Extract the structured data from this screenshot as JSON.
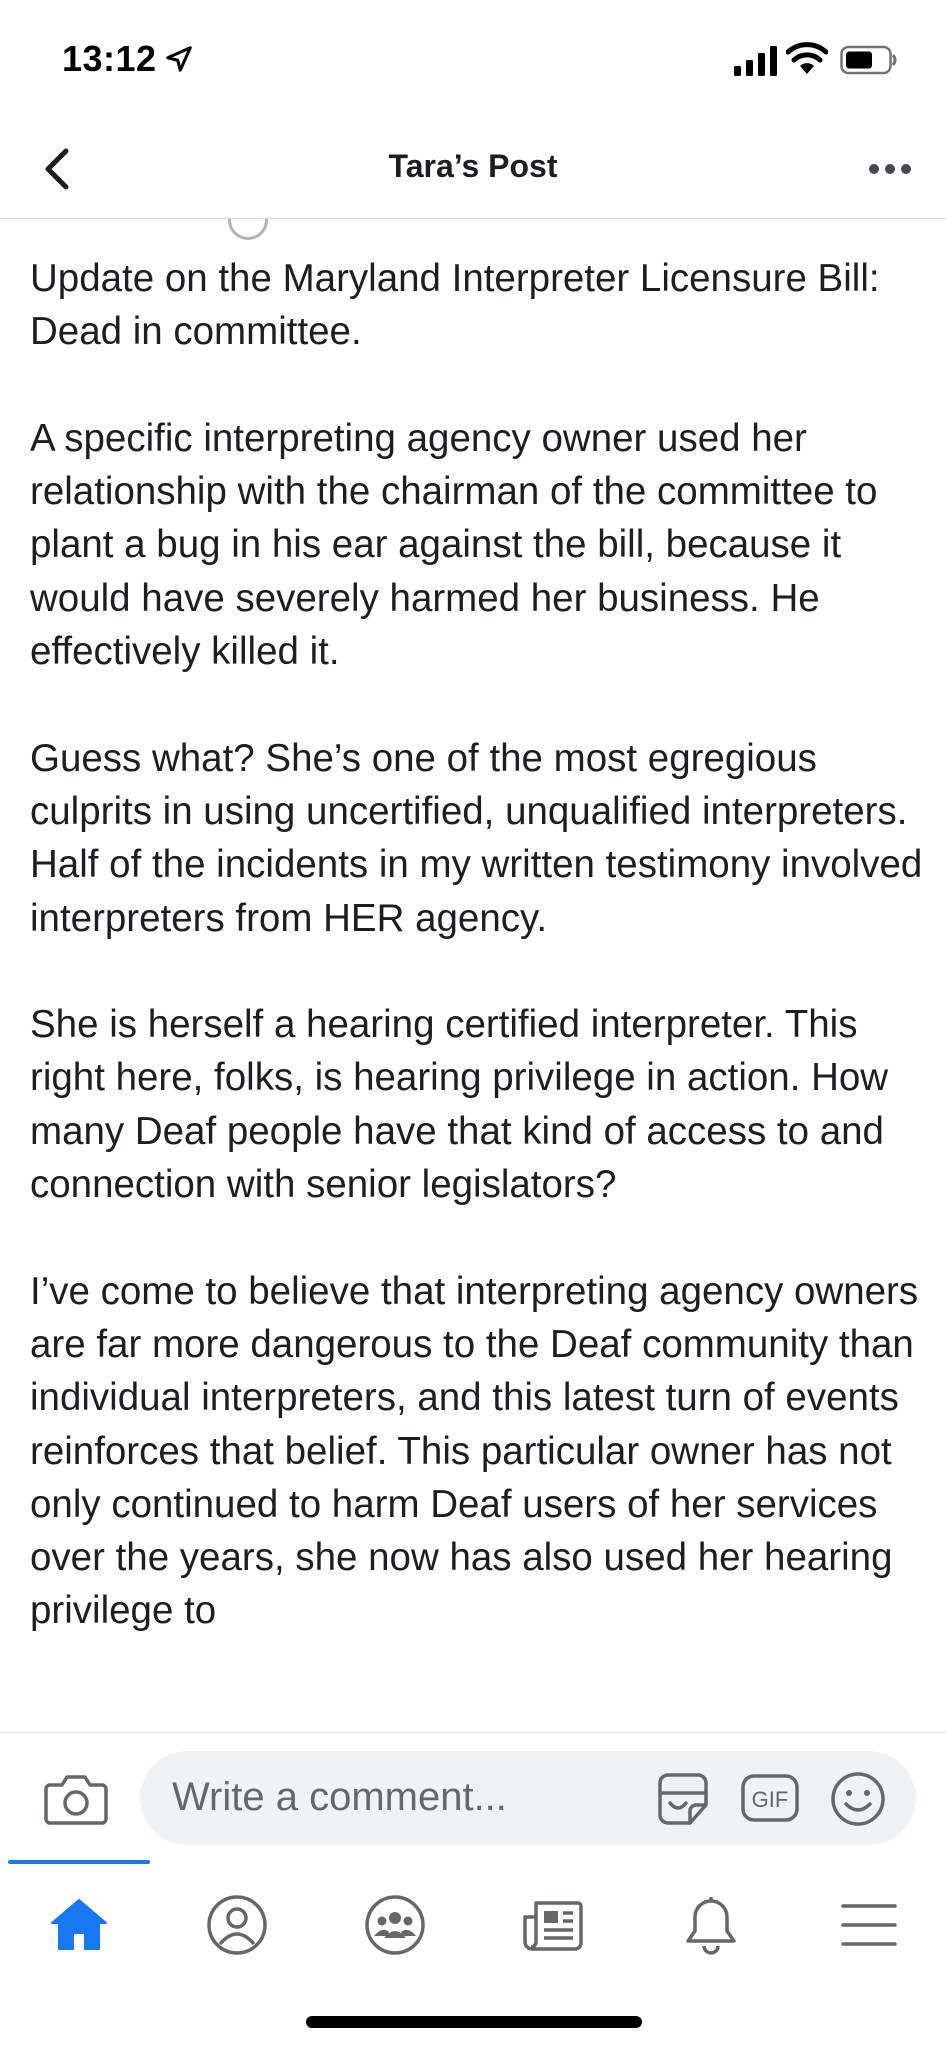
{
  "status_bar": {
    "time": "13:12",
    "icons": [
      "location-arrow-icon",
      "cellular-signal-icon",
      "wifi-icon",
      "battery-icon"
    ]
  },
  "nav": {
    "title": "Tara’s Post",
    "back_icon": "chevron-left-icon",
    "more_icon": "ellipsis-icon"
  },
  "post": {
    "paragraphs": [
      "Update on the Maryland Interpreter Licensure Bill: Dead in committee.",
      "A specific interpreting agency owner used her relationship with the chairman of the committee to plant a bug in his ear against the bill, because it would have severely harmed her business. He effectively killed it.",
      "Guess what? She’s one of the most egregious culprits in using uncertified, unqualified interpreters. Half of the incidents in my written testimony involved interpreters from HER agency.",
      "She is herself a hearing certified interpreter. This right here, folks, is hearing privilege in action. How many Deaf people have that kind of access to and connection with senior legislators?",
      "I’ve come to believe that interpreting agency owners are far more dangerous to the Deaf community than individual interpreters, and this latest turn of events reinforces that belief. This particular owner has not only continued to harm Deaf users of her services over the years, she now has also used her hearing privilege to"
    ]
  },
  "comment_bar": {
    "placeholder": "Write a comment...",
    "gif_label": "GIF",
    "icons": [
      "camera-icon",
      "sticker-icon",
      "gif-icon",
      "emoji-icon"
    ]
  },
  "tab_bar": {
    "active_tab": "home",
    "tabs": [
      {
        "id": "home",
        "icon": "home-icon"
      },
      {
        "id": "profile",
        "icon": "profile-icon"
      },
      {
        "id": "groups",
        "icon": "groups-icon"
      },
      {
        "id": "news",
        "icon": "news-icon"
      },
      {
        "id": "notifications",
        "icon": "bell-icon"
      },
      {
        "id": "menu",
        "icon": "hamburger-menu-icon"
      }
    ]
  },
  "colors": {
    "accent": "#1877f2",
    "icon_gray": "#65676b",
    "text": "#1c1e21",
    "input_bg": "#f0f2f5"
  }
}
